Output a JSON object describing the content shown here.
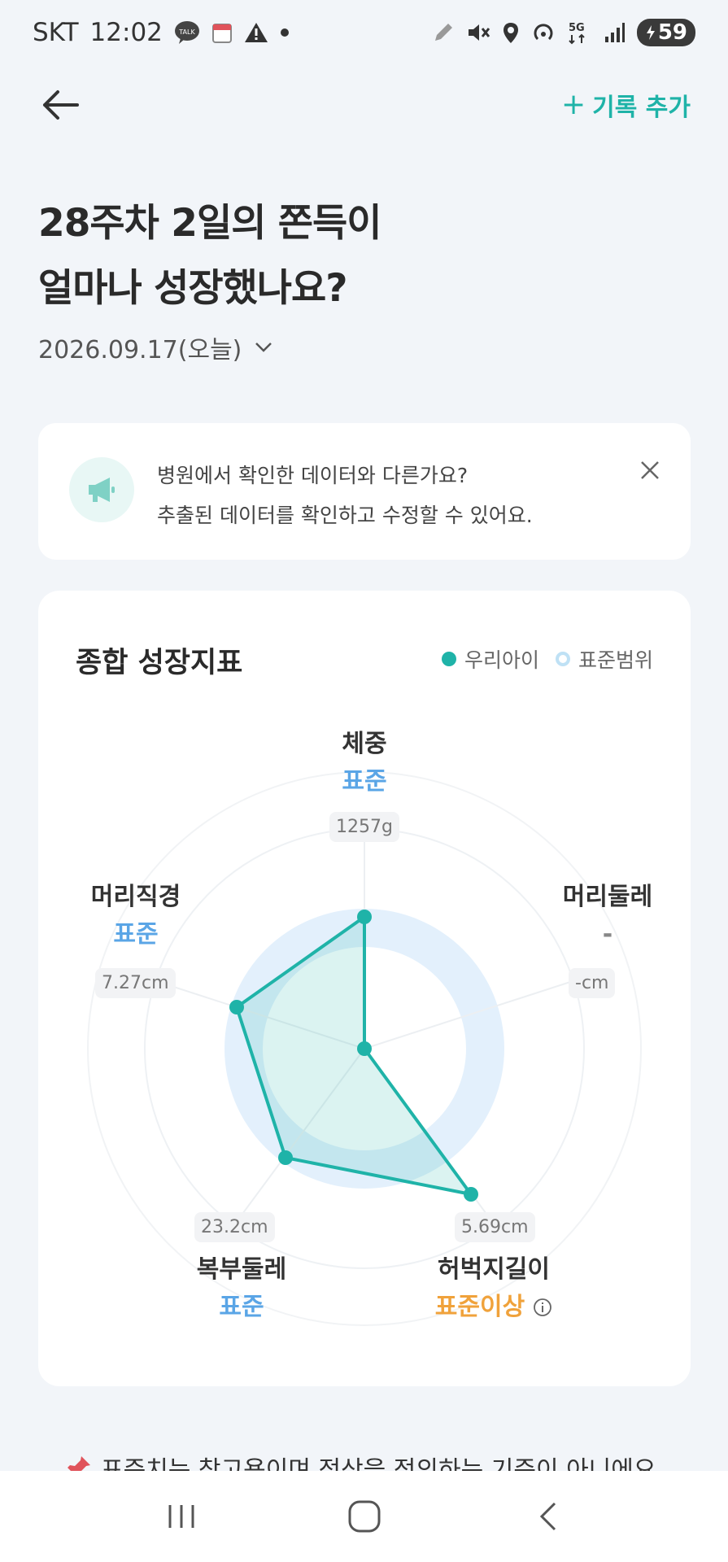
{
  "status_bar": {
    "carrier": "SKT",
    "time": "12:02",
    "talk_icon": "TALK",
    "battery": "59",
    "network": "5G"
  },
  "nav": {
    "back_icon": "back-arrow-icon",
    "add_record_label": "기록 추가"
  },
  "header": {
    "title_line1": "28주차 2일의 쫀득이",
    "title_line2": "얼마나 성장했나요?",
    "date": "2026.09.17(오늘)"
  },
  "notice": {
    "line1": "병원에서 확인한 데이터와 다른가요?",
    "line2": "추출된 데이터를 확인하고 수정할 수 있어요."
  },
  "growth": {
    "title": "종합 성장지표",
    "legend_ours": "우리아이",
    "legend_std": "표준범위",
    "axes": [
      {
        "label": "체중",
        "status": "표준",
        "value": "1257g"
      },
      {
        "label": "머리둘레",
        "status": "-",
        "value": "-cm"
      },
      {
        "label": "허벅지길이",
        "status": "표준이상",
        "value": "5.69cm"
      },
      {
        "label": "복부둘레",
        "status": "표준",
        "value": "23.2cm"
      },
      {
        "label": "머리직경",
        "status": "표준",
        "value": "7.27cm"
      }
    ],
    "accent_color": "#1fb3a8",
    "standard_color": "#5aa5e6",
    "above_color": "#f0a23b"
  },
  "footnote": "표준치는 참고용이며 정상을 정의하는 기준이 아니에요."
}
